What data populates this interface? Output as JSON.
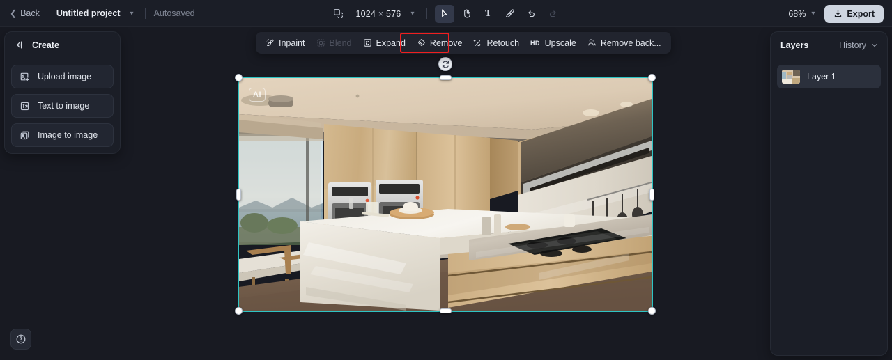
{
  "app": {
    "theme_bg": "#181a22",
    "panel_bg": "#1b1e27",
    "accent_selection": "#2ec4c4",
    "annotation_color": "#f01f1f"
  },
  "topbar": {
    "back_label": "Back",
    "project_title": "Untitled project",
    "project_caret_icon": "chevron-down-icon",
    "autosave_status": "Autosaved",
    "canvas_size_icon": "canvas-resize-icon",
    "canvas_width": "1024",
    "size_separator": "×",
    "canvas_height": "576",
    "size_caret_icon": "chevron-down-icon",
    "tools": [
      {
        "name": "select",
        "icon": "cursor-arrow-icon",
        "active": true,
        "disabled": false
      },
      {
        "name": "pan",
        "icon": "hand-icon",
        "active": false,
        "disabled": false
      },
      {
        "name": "text",
        "icon": "text-icon",
        "glyph": "T",
        "active": false,
        "disabled": false
      },
      {
        "name": "brush",
        "icon": "brush-icon",
        "active": false,
        "disabled": false
      },
      {
        "name": "undo",
        "icon": "undo-arrow-icon",
        "active": false,
        "disabled": false
      },
      {
        "name": "redo",
        "icon": "redo-arrow-icon",
        "active": false,
        "disabled": true
      }
    ],
    "zoom_level": "68%",
    "zoom_caret_icon": "chevron-down-icon",
    "export_label": "Export",
    "export_icon": "download-icon"
  },
  "left_panel": {
    "collapse_icon": "collapse-left-icon",
    "title": "Create",
    "items": [
      {
        "label": "Upload image",
        "icon": "upload-image-icon"
      },
      {
        "label": "Text to image",
        "icon": "text-to-image-icon"
      },
      {
        "label": "Image to image",
        "icon": "image-to-image-icon"
      }
    ]
  },
  "edit_toolbar": {
    "items": [
      {
        "label": "Inpaint",
        "icon": "inpaint-brush-icon",
        "disabled": false,
        "highlighted": false
      },
      {
        "label": "Blend",
        "icon": "blend-icon",
        "disabled": true,
        "highlighted": false
      },
      {
        "label": "Expand",
        "icon": "expand-frame-icon",
        "disabled": false,
        "highlighted": false
      },
      {
        "label": "Remove",
        "icon": "eraser-icon",
        "disabled": false,
        "highlighted": true
      },
      {
        "label": "Retouch",
        "icon": "retouch-sparkle-icon",
        "disabled": false,
        "highlighted": false
      },
      {
        "label": "Upscale",
        "icon": "hd-badge-icon",
        "badge": "HD",
        "disabled": false,
        "highlighted": false
      },
      {
        "label": "Remove back...",
        "icon": "remove-background-icon",
        "disabled": false,
        "highlighted": false
      }
    ]
  },
  "right_panel": {
    "title": "Layers",
    "history_label": "History",
    "history_caret_icon": "chevron-down-icon",
    "layers": [
      {
        "name": "Layer 1",
        "thumbnail": "kitchen-interior-thumbnail",
        "selected": true
      }
    ]
  },
  "canvas": {
    "selected_object": "kitchen-interior-image",
    "watermark_badge": "AI",
    "rotate_handle_icon": "rotate-icon",
    "handles": [
      "top-left",
      "top-center",
      "top-right",
      "middle-left",
      "middle-right",
      "bottom-left",
      "bottom-center",
      "bottom-right"
    ],
    "image_description": "Modern luxury kitchen interior with light oak cabinetry, marble waterfall island, stainless steel built-in double ovens, gas cooktop, range hood, hanging utensils, wooden dining table with chairs, and floor-to-ceiling window with ocean and mountain view"
  },
  "help": {
    "icon": "question-mark-circle-icon",
    "label": "Help"
  }
}
